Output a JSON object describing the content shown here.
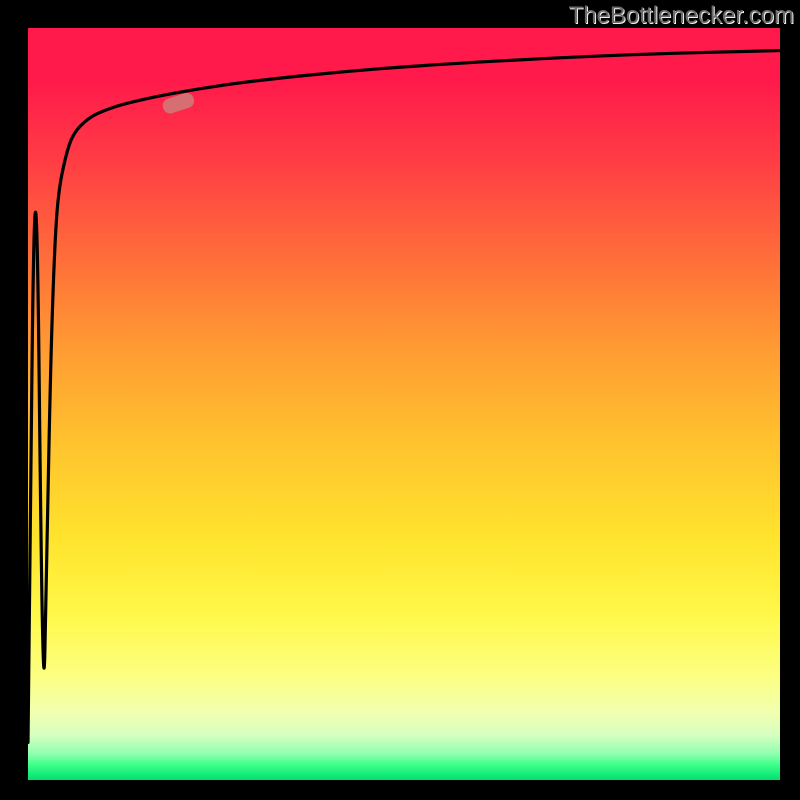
{
  "attribution": "TheBottlenecker.com",
  "chart_data": {
    "type": "line",
    "title": "",
    "xlabel": "",
    "ylabel": "",
    "xlim": [
      0,
      100
    ],
    "ylim": [
      0,
      100
    ],
    "series": [
      {
        "name": "curve",
        "x": [
          0,
          1,
          2,
          2.5,
          3,
          3.5,
          4,
          5,
          6,
          8,
          10,
          13,
          20,
          30,
          45,
          60,
          80,
          100
        ],
        "values": [
          5,
          99,
          5,
          30,
          55,
          70,
          78,
          83,
          86,
          88,
          89,
          90,
          91.5,
          93,
          94.5,
          95.5,
          96.5,
          97
        ]
      }
    ],
    "marker": {
      "x": 20,
      "y": 90,
      "length_pct": 6,
      "angle_deg": 18
    },
    "colors": {
      "curve": "#000000",
      "marker": "#d07878",
      "gradient_top": "#ff1a4b",
      "gradient_bottom": "#00e070"
    }
  }
}
